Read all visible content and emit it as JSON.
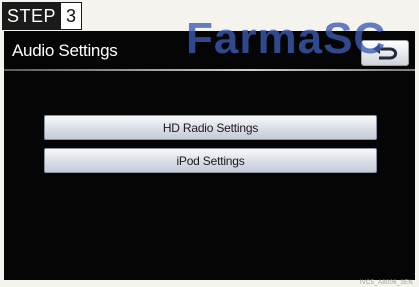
{
  "step": {
    "label": "STEP",
    "number": "3"
  },
  "watermark": "FarmaSC",
  "screen": {
    "title": "Audio Settings",
    "back_icon": "return-arrow-icon",
    "buttons": [
      {
        "label": "HD Radio Settings"
      },
      {
        "label": "iPod Settings"
      }
    ]
  },
  "caption": "IVC5_A8006_3EN"
}
